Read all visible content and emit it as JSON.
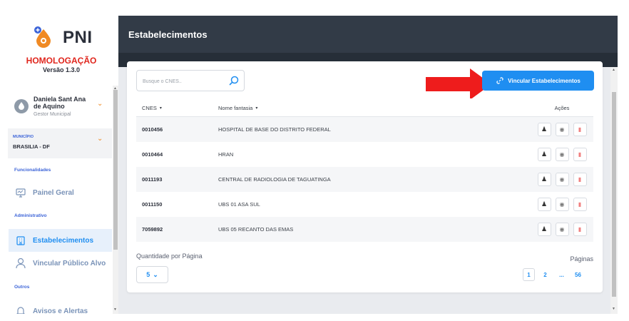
{
  "brand": {
    "name": "PNI",
    "environment": "HOMOLOGAÇÃO",
    "version": "Versão 1.3.0"
  },
  "user": {
    "name": "Daniela Sant Ana de Aquino",
    "role": "Gestor Municipal"
  },
  "municipio": {
    "label": "MUNICÍPIO",
    "value": "BRASILIA - DF"
  },
  "sidebar": {
    "sections": [
      {
        "label": "Funcionalidades"
      },
      {
        "label": "Administrativo"
      },
      {
        "label": "Outros"
      }
    ],
    "items": [
      {
        "label": "Painel Geral",
        "icon": "monitor-icon"
      },
      {
        "label": "Estabelecimentos",
        "icon": "building-icon",
        "active": true
      },
      {
        "label": "Vincular Público Alvo",
        "icon": "person-icon"
      },
      {
        "label": "Avisos e Alertas",
        "icon": "bell-icon"
      }
    ]
  },
  "header": {
    "title": "Estabelecimentos"
  },
  "search": {
    "placeholder": "Busque o CNES..",
    "value": ""
  },
  "actions": {
    "vincular_label": "Vincular Estabelecimentos"
  },
  "table": {
    "columns": [
      "CNES",
      "Nome fantasia",
      "Ações"
    ],
    "rows": [
      {
        "cnes": "0010456",
        "nome": "HOSPITAL DE BASE DO DISTRITO FEDERAL"
      },
      {
        "cnes": "0010464",
        "nome": "HRAN"
      },
      {
        "cnes": "0011193",
        "nome": "CENTRAL DE RADIOLOGIA DE TAGUATINGA"
      },
      {
        "cnes": "0011150",
        "nome": "UBS 01 ASA SUL"
      },
      {
        "cnes": "7059892",
        "nome": "UBS 05 RECANTO DAS EMAS"
      }
    ]
  },
  "pagination": {
    "per_page_label": "Quantidade por Página",
    "per_page_value": "5",
    "pages_label": "Páginas",
    "pages": [
      "1",
      "2",
      "...",
      "56"
    ],
    "current": "1"
  },
  "colors": {
    "accent": "#1f8ef1",
    "brand_orange": "#f08a24",
    "alert_red": "#e0261d",
    "topbar": "#323b47"
  }
}
